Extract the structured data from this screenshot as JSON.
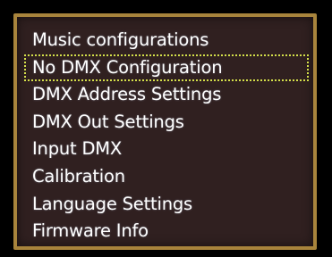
{
  "menu": {
    "items": [
      {
        "label": "Music configurations",
        "selected": false
      },
      {
        "label": "No DMX Configuration",
        "selected": true
      },
      {
        "label": "DMX Address Settings",
        "selected": false
      },
      {
        "label": "DMX Out Settings",
        "selected": false
      },
      {
        "label": "Input DMX",
        "selected": false
      },
      {
        "label": "Calibration",
        "selected": false
      },
      {
        "label": "Language Settings",
        "selected": false
      },
      {
        "label": "Firmware Info",
        "selected": false
      }
    ]
  },
  "colors": {
    "background": "#302020",
    "border": "#a8843c",
    "text": "#ffffff",
    "selection_outline": "#d4e04a"
  }
}
